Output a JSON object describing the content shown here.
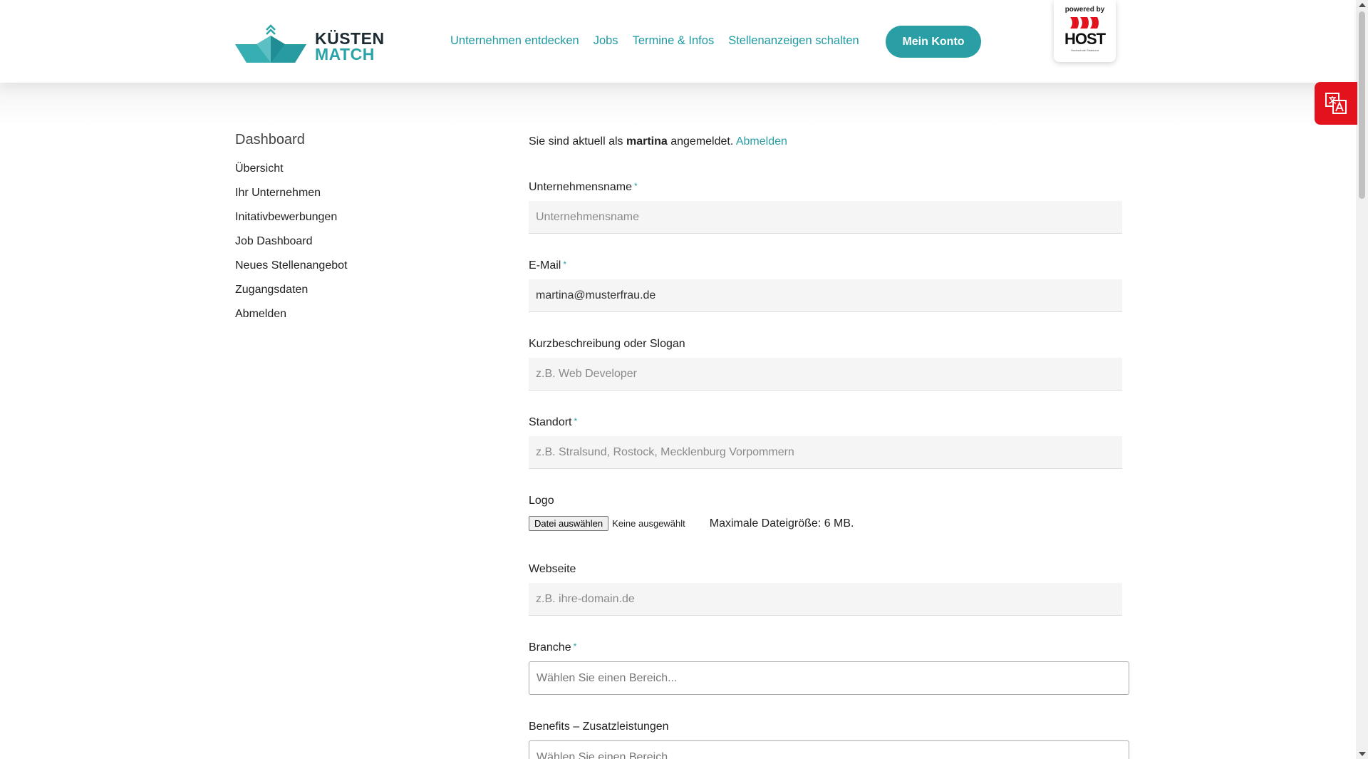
{
  "header": {
    "logo": {
      "line1": "KÜSTEN",
      "line2": "MATCH"
    },
    "nav": [
      {
        "label": "Unternehmen entdecken"
      },
      {
        "label": "Jobs"
      },
      {
        "label": "Termine & Infos"
      },
      {
        "label": "Stellenanzeigen schalten"
      }
    ],
    "account_button": "Mein Konto",
    "partner": {
      "powered_by": "powered by",
      "name": "HOST",
      "subtitle": "Hochschule Stralsund"
    }
  },
  "sidebar": {
    "title": "Dashboard",
    "items": [
      {
        "label": "Übersicht"
      },
      {
        "label": "Ihr Unternehmen"
      },
      {
        "label": "Initativbewerbungen"
      },
      {
        "label": "Job Dashboard"
      },
      {
        "label": "Neues Stellenangebot"
      },
      {
        "label": "Zugangsdaten"
      },
      {
        "label": "Abmelden"
      }
    ]
  },
  "main": {
    "login": {
      "prefix": "Sie sind aktuell als",
      "user": "martina",
      "suffix": "angemeldet.",
      "logout": "Abmelden"
    },
    "fields": {
      "company": {
        "label": "Unternehmensname",
        "required": "*",
        "value": "",
        "placeholder": "Unternehmensname"
      },
      "email": {
        "label": "E-Mail",
        "required": "*",
        "value": "martina@musterfrau.de",
        "placeholder": ""
      },
      "slogan": {
        "label": "Kurzbeschreibung oder Slogan",
        "value": "",
        "placeholder": "z.B. Web Developer"
      },
      "location": {
        "label": "Standort",
        "required": "*",
        "value": "",
        "placeholder": "z.B. Stralsund, Rostock, Mecklenburg Vorpommern"
      },
      "logo": {
        "label": "Logo",
        "button": "Datei auswählen",
        "status": "Keine ausgewählt",
        "hint": "Maximale Dateigröße: 6 MB."
      },
      "website": {
        "label": "Webseite",
        "value": "",
        "placeholder": "z.B. ihre-domain.de"
      },
      "branch": {
        "label": "Branche",
        "required": "*",
        "placeholder": "Wählen Sie einen Bereich..."
      },
      "benefits": {
        "label": "Benefits – Zusatzleistungen",
        "placeholder": "Wählen Sie einen Bereich..."
      }
    }
  },
  "colors": {
    "accent": "#2a9ea5",
    "translate_tab": "#e3131e",
    "logo_dark": "#1d2b33"
  }
}
